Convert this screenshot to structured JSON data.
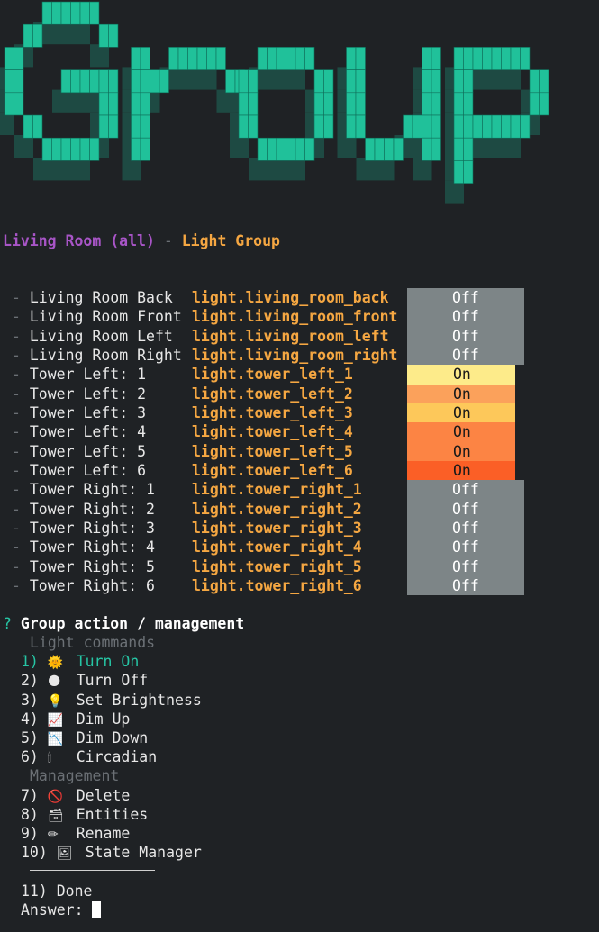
{
  "banner": {
    "text": "Group",
    "shadow_color": "#1e4a43",
    "color": "#20c19a"
  },
  "header": {
    "name": "Living Room (all)",
    "separator": " - ",
    "kind": "Light Group"
  },
  "entities": [
    {
      "label": "Living Room Back",
      "entity_id": "light.living_room_back",
      "state": "Off",
      "color": "#7d8587"
    },
    {
      "label": "Living Room Front",
      "entity_id": "light.living_room_front",
      "state": "Off",
      "color": "#7d8587"
    },
    {
      "label": "Living Room Left",
      "entity_id": "light.living_room_left",
      "state": "Off",
      "color": "#7d8587"
    },
    {
      "label": "Living Room Right",
      "entity_id": "light.living_room_right",
      "state": "Off",
      "color": "#7d8587"
    },
    {
      "label": "Tower Left: 1",
      "entity_id": "light.tower_left_1",
      "state": "On",
      "color": "#fdeb8a"
    },
    {
      "label": "Tower Left: 2",
      "entity_id": "light.tower_left_2",
      "state": "On",
      "color": "#fba15b"
    },
    {
      "label": "Tower Left: 3",
      "entity_id": "light.tower_left_3",
      "state": "On",
      "color": "#fdc85a"
    },
    {
      "label": "Tower Left: 4",
      "entity_id": "light.tower_left_4",
      "state": "On",
      "color": "#fc8444"
    },
    {
      "label": "Tower Left: 5",
      "entity_id": "light.tower_left_5",
      "state": "On",
      "color": "#fc8444"
    },
    {
      "label": "Tower Left: 6",
      "entity_id": "light.tower_left_6",
      "state": "On",
      "color": "#fb5f26"
    },
    {
      "label": "Tower Right: 1",
      "entity_id": "light.tower_right_1",
      "state": "Off",
      "color": "#7d8587"
    },
    {
      "label": "Tower Right: 2",
      "entity_id": "light.tower_right_2",
      "state": "Off",
      "color": "#7d8587"
    },
    {
      "label": "Tower Right: 3",
      "entity_id": "light.tower_right_3",
      "state": "Off",
      "color": "#7d8587"
    },
    {
      "label": "Tower Right: 4",
      "entity_id": "light.tower_right_4",
      "state": "Off",
      "color": "#7d8587"
    },
    {
      "label": "Tower Right: 5",
      "entity_id": "light.tower_right_5",
      "state": "Off",
      "color": "#7d8587"
    },
    {
      "label": "Tower Right: 6",
      "entity_id": "light.tower_right_6",
      "state": "Off",
      "color": "#7d8587"
    }
  ],
  "prompt": {
    "marker": "?",
    "question": "Group action / management",
    "sections": [
      {
        "title": "Light commands",
        "items": [
          {
            "num": "1)",
            "icon": "🌞",
            "icon_name": "sun-icon",
            "label": "Turn On",
            "selected": true
          },
          {
            "num": "2)",
            "icon": "🌑",
            "icon_name": "moon-icon",
            "label": "Turn Off",
            "selected": false
          },
          {
            "num": "3)",
            "icon": "💡",
            "icon_name": "bulb-icon",
            "label": "Set Brightness",
            "selected": false
          },
          {
            "num": "4)",
            "icon": "📈",
            "icon_name": "chart-up-icon",
            "label": "Dim Up",
            "selected": false
          },
          {
            "num": "5)",
            "icon": "📉",
            "icon_name": "chart-down-icon",
            "label": "Dim Down",
            "selected": false
          },
          {
            "num": "6)",
            "icon": "🕯",
            "icon_name": "candle-icon",
            "label": "Circadian",
            "selected": false
          }
        ]
      },
      {
        "title": "Management",
        "items": [
          {
            "num": "7)",
            "icon": "🚫",
            "icon_name": "prohibited-icon",
            "label": "Delete",
            "selected": false
          },
          {
            "num": "8)",
            "icon": "🗃",
            "icon_name": "card-box-icon",
            "label": "Entities",
            "selected": false
          },
          {
            "num": "9)",
            "icon": "✏",
            "icon_name": "pencil-icon",
            "label": "Rename",
            "selected": false
          },
          {
            "num": "10)",
            "icon": "🖼",
            "icon_name": "picture-icon",
            "label": "State Manager",
            "selected": false
          }
        ]
      }
    ],
    "done": {
      "num": "11)",
      "label": "Done"
    },
    "answer_label": "Answer: "
  }
}
